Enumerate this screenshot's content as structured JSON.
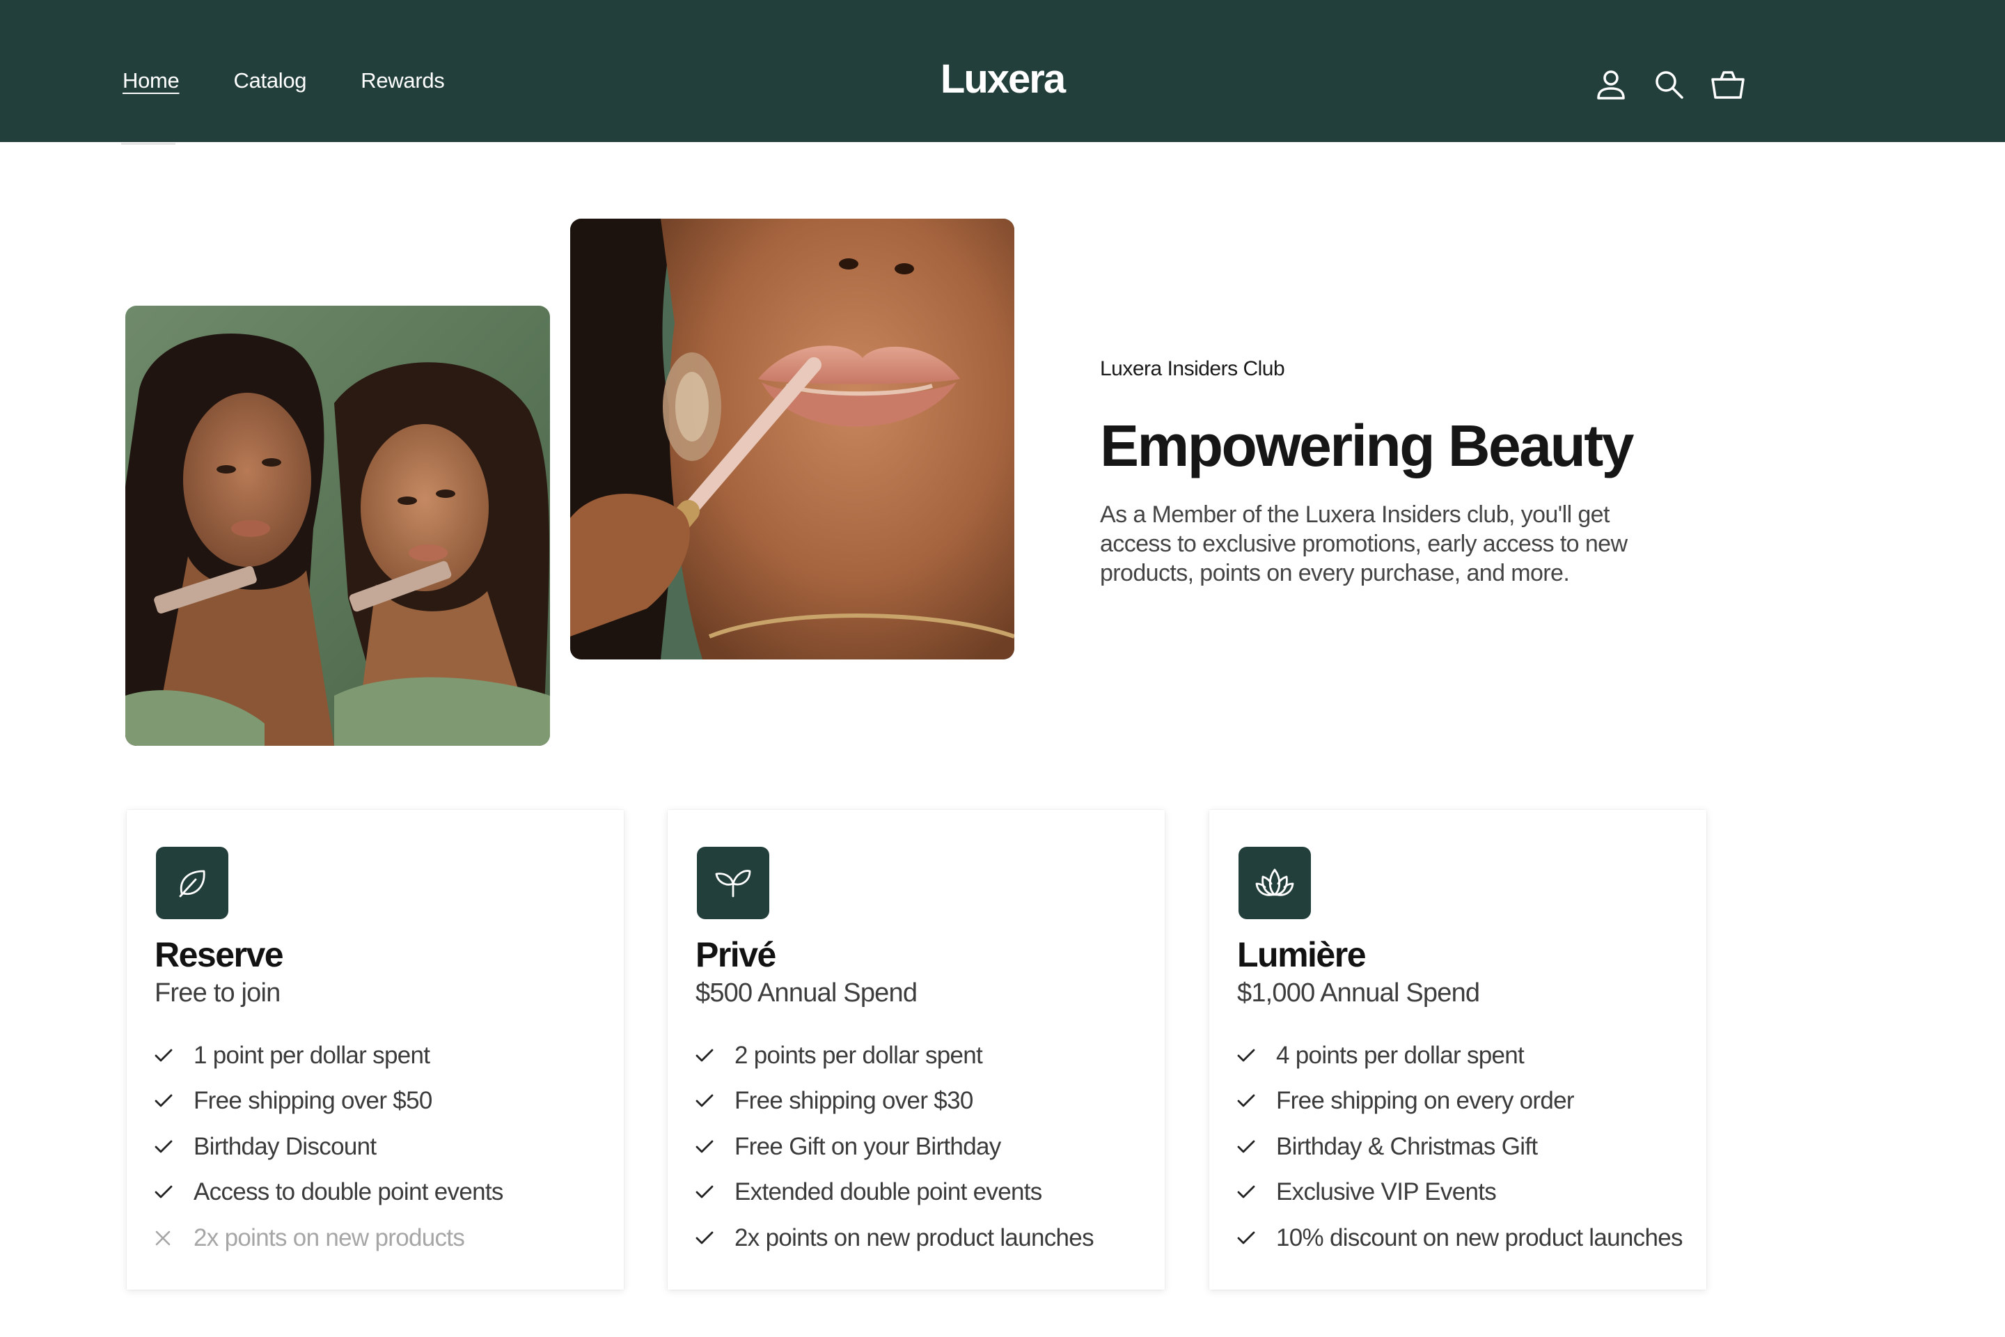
{
  "header": {
    "brand": "Luxera",
    "nav": [
      {
        "label": "Home",
        "active": true
      },
      {
        "label": "Catalog",
        "active": false
      },
      {
        "label": "Rewards",
        "active": false
      }
    ],
    "icons": [
      "account-icon",
      "search-icon",
      "cart-icon"
    ],
    "background": "#233f3b"
  },
  "hero": {
    "eyebrow": "Luxera Insiders Club",
    "title": "Empowering Beauty",
    "intro": "As a Member of the Luxera Insiders club, you'll get access to exclusive promotions, early access to new products, points on every purchase, and more.",
    "images": [
      "two-women-holding-lip-gloss-photo",
      "woman-applying-lip-gloss-photo"
    ]
  },
  "tiers": [
    {
      "icon": "leaf-icon",
      "name": "Reserve",
      "subtitle": "Free to join",
      "benefits": [
        {
          "text": "1 point per dollar spent",
          "included": true
        },
        {
          "text": "Free shipping over $50",
          "included": true
        },
        {
          "text": "Birthday Discount",
          "included": true
        },
        {
          "text": "Access to double point events",
          "included": true
        },
        {
          "text": "2x points on new products",
          "included": false
        }
      ]
    },
    {
      "icon": "sprout-icon",
      "name": "Privé",
      "subtitle": "$500 Annual Spend",
      "benefits": [
        {
          "text": "2 points per dollar spent",
          "included": true
        },
        {
          "text": "Free shipping over $30",
          "included": true
        },
        {
          "text": "Free Gift on your Birthday",
          "included": true
        },
        {
          "text": "Extended double point events",
          "included": true
        },
        {
          "text": "2x points on new product launches",
          "included": true
        }
      ]
    },
    {
      "icon": "lotus-icon",
      "name": "Lumière",
      "subtitle": "$1,000 Annual Spend",
      "benefits": [
        {
          "text": "4 points per dollar spent",
          "included": true
        },
        {
          "text": "Free shipping on every order",
          "included": true
        },
        {
          "text": "Birthday & Christmas Gift",
          "included": true
        },
        {
          "text": "Exclusive VIP Events",
          "included": true
        },
        {
          "text": "10% discount on new product launches",
          "included": true
        }
      ]
    }
  ],
  "colors": {
    "brand_dark_green": "#223f3b",
    "check": "#222222",
    "cross": "#a6a6a6"
  }
}
